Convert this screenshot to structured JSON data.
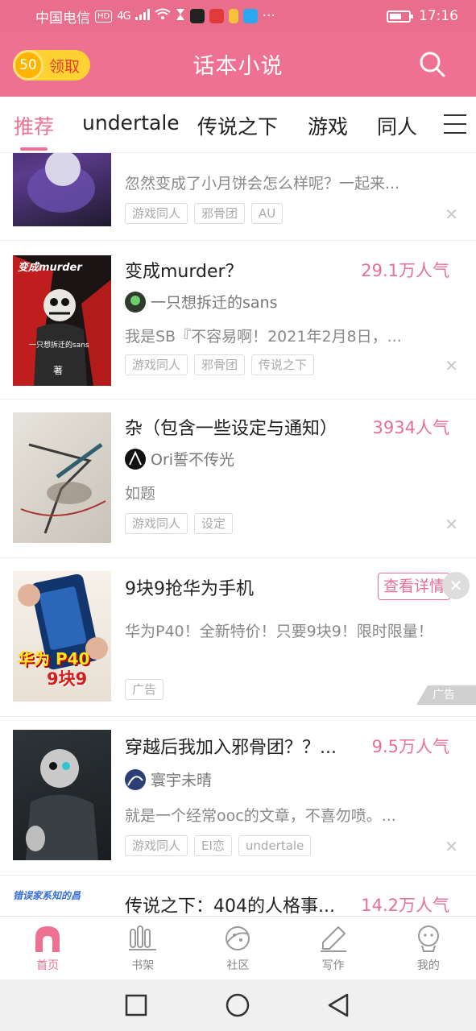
{
  "status_bar": {
    "carrier": "中国电信",
    "hd": "HD",
    "network": "4G",
    "time": "17:16",
    "more": "···"
  },
  "header": {
    "reward_coin": "50",
    "reward_label": "领取",
    "app_title": "话本小说"
  },
  "tabs": [
    {
      "label": "推荐"
    },
    {
      "label": "undertale"
    },
    {
      "label": "传说之下"
    },
    {
      "label": "游戏"
    },
    {
      "label": "同人"
    }
  ],
  "feed": {
    "partial_item": {
      "desc": "忽然变成了小月饼会怎么样呢？一起来...",
      "tags": [
        "游戏同人",
        "邪骨团",
        "AU"
      ]
    },
    "items": [
      {
        "title": "变成murder？",
        "popularity": "29.1万人气",
        "author": "一只想拆迁的sans",
        "desc": "我是SB『不容易啊！2021年2月8日，...",
        "tags": [
          "游戏同人",
          "邪骨团",
          "传说之下"
        ],
        "cover_text": "变成murder",
        "cover_sub": "一只想拆迁的sans",
        "cover_by": "著"
      },
      {
        "title": "杂（包含一些设定与通知）",
        "popularity": "3934人气",
        "author": "Ori誓不传光",
        "desc": "如题",
        "tags": [
          "游戏同人",
          "设定"
        ]
      }
    ],
    "ad": {
      "title": "9块9抢华为手机",
      "button": "查看详情",
      "desc": "华为P40！全新特价！只要9块9！限时限量！",
      "tag": "广告",
      "mark": "广告",
      "cover_line1": "华为 P40",
      "cover_line2": "9块9"
    },
    "items2": [
      {
        "title": "穿越后我加入邪骨团？？...",
        "popularity": "9.5万人气",
        "author": "寰宇未晴",
        "desc": "就是一个经常ooc的文章，不喜勿喷。...",
        "tags": [
          "游戏同人",
          "EI恋",
          "undertale"
        ]
      },
      {
        "title": "传说之下：404的人格事...",
        "popularity": "14.2万人气",
        "cover_text": "错误家系知的昌"
      }
    ]
  },
  "bottom_nav": [
    {
      "label": "首页",
      "icon": "home-icon"
    },
    {
      "label": "书架",
      "icon": "bookshelf-icon"
    },
    {
      "label": "社区",
      "icon": "community-icon"
    },
    {
      "label": "写作",
      "icon": "pen-icon"
    },
    {
      "label": "我的",
      "icon": "profile-icon"
    }
  ],
  "colors": {
    "accent": "#ef7192",
    "popularity": "#e86f96",
    "coin": "#ffd234"
  }
}
